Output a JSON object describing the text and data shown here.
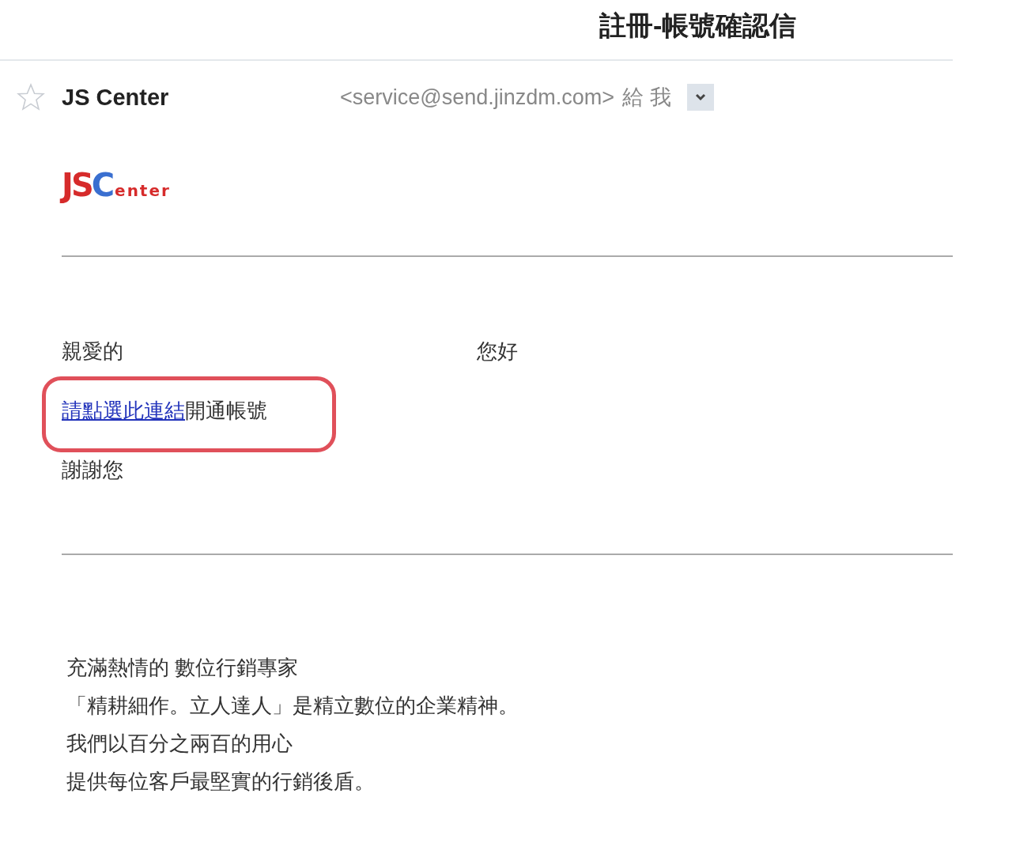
{
  "subject": "註冊-帳號確認信",
  "header": {
    "starred": false,
    "sender_name": "JS Center",
    "sender_email": "<service@send.jinzdm.com>",
    "recipient": "給 我"
  },
  "logo": {
    "lead": "JS",
    "mark": "C",
    "tail": "enter"
  },
  "greeting": {
    "salutation": "親愛的",
    "hello": "您好"
  },
  "activation": {
    "link": "請點選此連結",
    "text": "開通帳號",
    "highlighted": true
  },
  "thanks": "謝謝您",
  "footer_lines": [
    "充滿熱情的 數位行銷專家",
    "「精耕細作。立人達人」是精立數位的企業精神。",
    "我們以百分之兩百的用心",
    "提供每位客戶最堅實的行銷後盾。"
  ]
}
